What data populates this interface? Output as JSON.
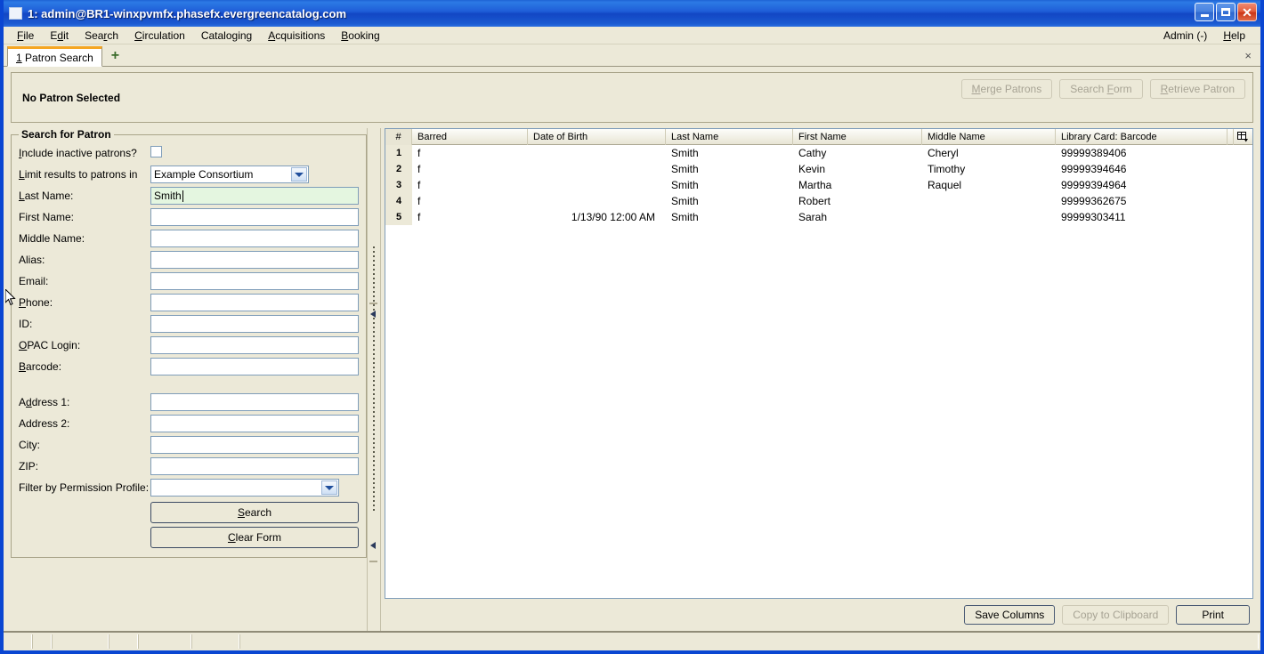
{
  "window": {
    "title": "1: admin@BR1-winxpvmfx.phasefx.evergreencatalog.com",
    "minimize_label": "Minimize",
    "maximize_label": "Maximize",
    "close_label": "✕"
  },
  "menubar": {
    "items": [
      {
        "label": "File",
        "accel": "F"
      },
      {
        "label": "Edit",
        "accel": "d"
      },
      {
        "label": "Search",
        "accel": "r"
      },
      {
        "label": "Circulation",
        "accel": "C"
      },
      {
        "label": "Cataloging",
        "accel": "g"
      },
      {
        "label": "Acquisitions",
        "accel": "A"
      },
      {
        "label": "Booking",
        "accel": "B"
      }
    ],
    "admin_label": "Admin (-)",
    "help_label": "Help"
  },
  "tabs": {
    "active": {
      "number": "1",
      "label": "Patron Search"
    },
    "add_label": "+",
    "close_label": "×"
  },
  "patron_bar": {
    "status": "No Patron Selected",
    "buttons": [
      {
        "label": "Merge Patrons",
        "enabled": false
      },
      {
        "label": "Search Form",
        "enabled": false
      },
      {
        "label": "Retrieve Patron",
        "enabled": false
      }
    ]
  },
  "search_form": {
    "legend": "Search for Patron",
    "include_inactive": {
      "label": "Include inactive patrons?",
      "checked": false
    },
    "limit_results": {
      "label": "Limit results to patrons in",
      "value": "Example Consortium"
    },
    "fields": [
      {
        "label": "Last Name:",
        "value": "Smith",
        "focused": true
      },
      {
        "label": "First Name:",
        "value": "",
        "focused": false
      },
      {
        "label": "Middle Name:",
        "value": "",
        "focused": false
      },
      {
        "label": "Alias:",
        "value": "",
        "focused": false
      },
      {
        "label": "Email:",
        "value": "",
        "focused": false
      },
      {
        "label": "Phone:",
        "value": "",
        "focused": false
      },
      {
        "label": "ID:",
        "value": "",
        "focused": false
      },
      {
        "label": "OPAC Login:",
        "value": "",
        "focused": false
      },
      {
        "label": "Barcode:",
        "value": "",
        "focused": false
      }
    ],
    "address_fields": [
      {
        "label": "Address 1:",
        "value": ""
      },
      {
        "label": "Address 2:",
        "value": ""
      },
      {
        "label": "City:",
        "value": ""
      },
      {
        "label": "ZIP:",
        "value": ""
      }
    ],
    "permission_profile": {
      "label": "Filter by Permission Profile:",
      "value": ""
    },
    "search_button": "Search",
    "clear_button": "Clear Form"
  },
  "results": {
    "columns": [
      "#",
      "Barred",
      "Date of Birth",
      "Last Name",
      "First Name",
      "Middle Name",
      "Library Card: Barcode"
    ],
    "rows": [
      {
        "num": "1",
        "barred": "f",
        "dob": "",
        "last": "Smith",
        "first": "Cathy",
        "middle": "Cheryl",
        "barcode": "99999389406"
      },
      {
        "num": "2",
        "barred": "f",
        "dob": "",
        "last": "Smith",
        "first": "Kevin",
        "middle": "Timothy",
        "barcode": "99999394646"
      },
      {
        "num": "3",
        "barred": "f",
        "dob": "",
        "last": "Smith",
        "first": "Martha",
        "middle": "Raquel",
        "barcode": "99999394964"
      },
      {
        "num": "4",
        "barred": "f",
        "dob": "",
        "last": "Smith",
        "first": "Robert",
        "middle": "",
        "barcode": "99999362675"
      },
      {
        "num": "5",
        "barred": "f",
        "dob": "1/13/90 12:00 AM",
        "last": "Smith",
        "first": "Sarah",
        "middle": "",
        "barcode": "99999303411"
      }
    ],
    "actions": [
      {
        "label": "Save Columns",
        "enabled": true
      },
      {
        "label": "Copy to Clipboard",
        "enabled": false
      },
      {
        "label": "Print",
        "enabled": true
      }
    ]
  },
  "statusbar": {
    "panels": [
      "",
      "",
      "",
      "",
      "",
      "",
      ""
    ]
  },
  "colors": {
    "titlebar_blue": "#1f5ed8",
    "window_border": "#0a46d2",
    "face": "#ece9d8",
    "field_border": "#7f9db9",
    "focus_field_bg": "#e4f6e0",
    "tab_accent": "#f5a623"
  }
}
